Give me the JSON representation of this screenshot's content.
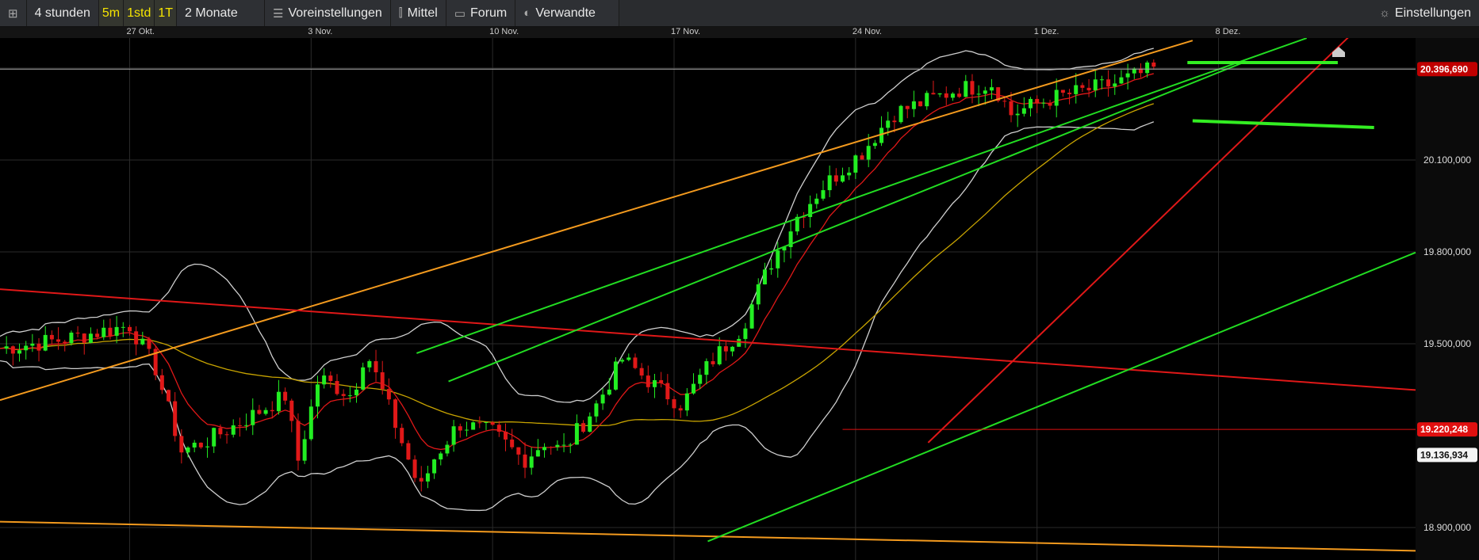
{
  "toolbar": {
    "interval": "4 stunden",
    "quick": [
      "5m",
      "1std",
      "1T"
    ],
    "range": "2 Monate",
    "presets": "Voreinstellungen",
    "indicators": "Mittel",
    "forum": "Forum",
    "related": "Verwandte",
    "settings": "Einstellungen"
  },
  "chart_data": {
    "type": "candlestick",
    "x_labels": [
      {
        "day": 0,
        "label": "27 Okt."
      },
      {
        "day": 7,
        "label": "3 Nov."
      },
      {
        "day": 14,
        "label": "10 Nov."
      },
      {
        "day": 21,
        "label": "17 Nov."
      },
      {
        "day": 28,
        "label": "24 Nov."
      },
      {
        "day": 35,
        "label": "1 Dez."
      },
      {
        "day": 42,
        "label": "8 Dez."
      }
    ],
    "x_range_days": [
      -5,
      49.6
    ],
    "ylim": [
      18820000,
      20520000
    ],
    "y_ticks": [
      {
        "v": 20400000,
        "label": "20.400,000"
      },
      {
        "v": 20100000,
        "label": "20.100,000"
      },
      {
        "v": 19800000,
        "label": "19.800,000"
      },
      {
        "v": 19500000,
        "label": "19.500,000"
      },
      {
        "v": 18900000,
        "label": "18.900,000"
      }
    ],
    "last_price": {
      "v": 20396690,
      "label": "20.396,690",
      "color": "#c00000"
    },
    "level_red": {
      "v": 19220248,
      "label": "19.220,248",
      "from_day": 27.5,
      "color": "#e01010"
    },
    "level_white": {
      "v": 19136934,
      "label": "19.136,934"
    },
    "price_path": [
      [
        -5,
        19485000
      ],
      [
        -2.5,
        19515000
      ],
      [
        0,
        19560000
      ],
      [
        1,
        19420000
      ],
      [
        2,
        19150000
      ],
      [
        2.9,
        19180000
      ],
      [
        4.2,
        19240000
      ],
      [
        6,
        19330000
      ],
      [
        6.5,
        19120000
      ],
      [
        7.3,
        19390000
      ],
      [
        8.6,
        19330000
      ],
      [
        9.1,
        19480000
      ],
      [
        10.1,
        19270000
      ],
      [
        11.2,
        19020000
      ],
      [
        11.7,
        19120000
      ],
      [
        12.7,
        19240000
      ],
      [
        14,
        19210000
      ],
      [
        15.2,
        19120000
      ],
      [
        16,
        19180000
      ],
      [
        16.7,
        19150000
      ],
      [
        18,
        19300000
      ],
      [
        19,
        19450000
      ],
      [
        20.3,
        19360000
      ],
      [
        21.3,
        19300000
      ],
      [
        22.4,
        19440000
      ],
      [
        23.6,
        19550000
      ],
      [
        24.7,
        19760000
      ],
      [
        25.7,
        19910000
      ],
      [
        26.7,
        20010000
      ],
      [
        28.3,
        20130000
      ],
      [
        29.4,
        20250000
      ],
      [
        31.9,
        20330000
      ],
      [
        33.3,
        20350000
      ],
      [
        34,
        20250000
      ],
      [
        35.5,
        20300000
      ],
      [
        37,
        20330000
      ],
      [
        38,
        20350000
      ],
      [
        39.5,
        20396690
      ]
    ],
    "trendlines": [
      {
        "color": "#f39a1e",
        "p1": [
          -5,
          19316000
        ],
        "p2": [
          41,
          20490000
        ]
      },
      {
        "color": "#f39a1e",
        "p1": [
          -5,
          18919000
        ],
        "p2": [
          49.6,
          18824000
        ]
      },
      {
        "color": "#e01818",
        "p1": [
          -5,
          19678000
        ],
        "p2": [
          49.6,
          19349000
        ]
      },
      {
        "color": "#22dd22",
        "p1": [
          11.07,
          19469000
        ],
        "p2": [
          45.4,
          20498000
        ]
      },
      {
        "color": "#22dd22",
        "p1": [
          12.3,
          19377000
        ],
        "p2": [
          43,
          20420000
        ]
      },
      {
        "color": "#22dd22",
        "p1": [
          22.3,
          18855000
        ],
        "p2": [
          49.6,
          19798000
        ]
      },
      {
        "color": "#e01818",
        "p1": [
          30.8,
          19177000
        ],
        "p2": [
          47,
          20500000
        ]
      },
      {
        "color": "#33ee22",
        "p1": [
          40.8,
          20418000
        ],
        "p2": [
          46.6,
          20418000
        ],
        "thick": true
      },
      {
        "color": "#33ee22",
        "p1": [
          41,
          20228000
        ],
        "p2": [
          48,
          20206000
        ],
        "thick": true
      }
    ],
    "indicators": [
      "Bollinger (20,2)",
      "SMA 50",
      "EMA 9"
    ]
  }
}
